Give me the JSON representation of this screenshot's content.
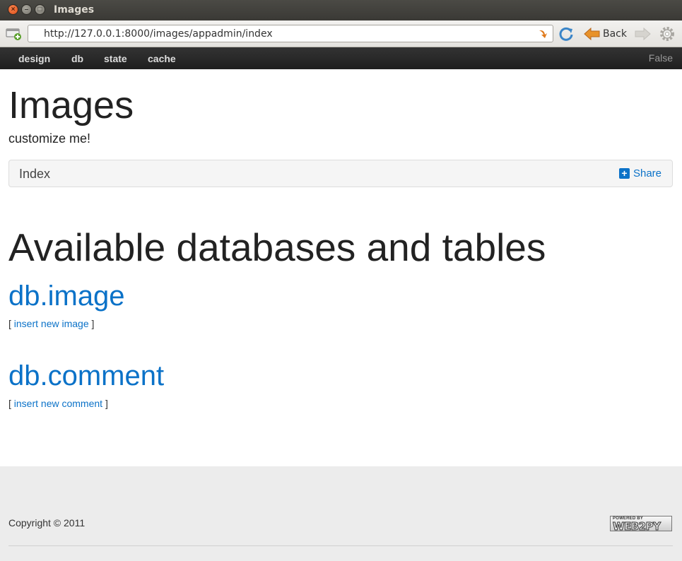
{
  "window": {
    "title": "Images"
  },
  "browser": {
    "url": "http://127.0.0.1:8000/images/appadmin/index",
    "back_label": "Back"
  },
  "navbar": {
    "items": [
      {
        "label": "design"
      },
      {
        "label": "db"
      },
      {
        "label": "state"
      },
      {
        "label": "cache"
      }
    ],
    "right_text": "False"
  },
  "page": {
    "title": "Images",
    "subtitle": "customize me!",
    "breadcrumb": "Index",
    "share_label": "Share",
    "section_title": "Available databases and tables",
    "tables": [
      {
        "name": "db.image",
        "insert_label": "insert new image"
      },
      {
        "name": "db.comment",
        "insert_label": "insert new comment"
      }
    ]
  },
  "footer": {
    "copyright": "Copyright © 2011",
    "badge_top": "POWERED BY",
    "badge_main": "WEB2PY"
  },
  "colors": {
    "link": "#0b72c8",
    "navbar": "#222222",
    "footer": "#ececec"
  }
}
